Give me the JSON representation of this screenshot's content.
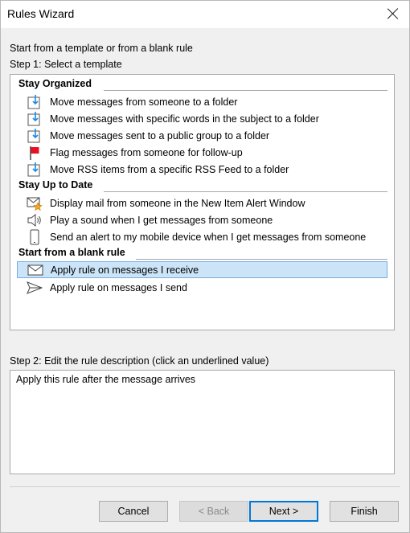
{
  "window": {
    "title": "Rules Wizard"
  },
  "intro": "Start from a template or from a blank rule",
  "step1_label": "Step 1: Select a template",
  "groups": {
    "stay_organized": "Stay Organized",
    "stay_up_to_date": "Stay Up to Date",
    "blank_rule": "Start from a blank rule"
  },
  "templates": [
    {
      "label": "Move messages from someone to a folder",
      "icon": "move-to-folder-icon"
    },
    {
      "label": "Move messages with specific words in the subject to a folder",
      "icon": "move-to-folder-icon"
    },
    {
      "label": "Move messages sent to a public group to a folder",
      "icon": "move-to-folder-icon"
    },
    {
      "label": "Flag messages from someone for follow-up",
      "icon": "flag-icon"
    },
    {
      "label": "Move RSS items from a specific RSS Feed to a folder",
      "icon": "move-to-folder-icon"
    },
    {
      "label": "Display mail from someone in the New Item Alert Window",
      "icon": "new-item-alert-icon"
    },
    {
      "label": "Play a sound when I get messages from someone",
      "icon": "speaker-icon"
    },
    {
      "label": "Send an alert to my mobile device when I get messages from someone",
      "icon": "mobile-device-icon"
    },
    {
      "label": "Apply rule on messages I receive",
      "icon": "envelope-icon",
      "selected": true
    },
    {
      "label": "Apply rule on messages I send",
      "icon": "send-icon"
    }
  ],
  "step2_label": "Step 2: Edit the rule description (click an underlined value)",
  "rule_description": "Apply this rule after the message arrives",
  "buttons": {
    "cancel": "Cancel",
    "back": "< Back",
    "next": "Next >",
    "finish": "Finish"
  },
  "colors": {
    "selection": "#cce4f7",
    "selection_border": "#78aee0",
    "accent": "#0078d7",
    "flag": "#e81123"
  }
}
